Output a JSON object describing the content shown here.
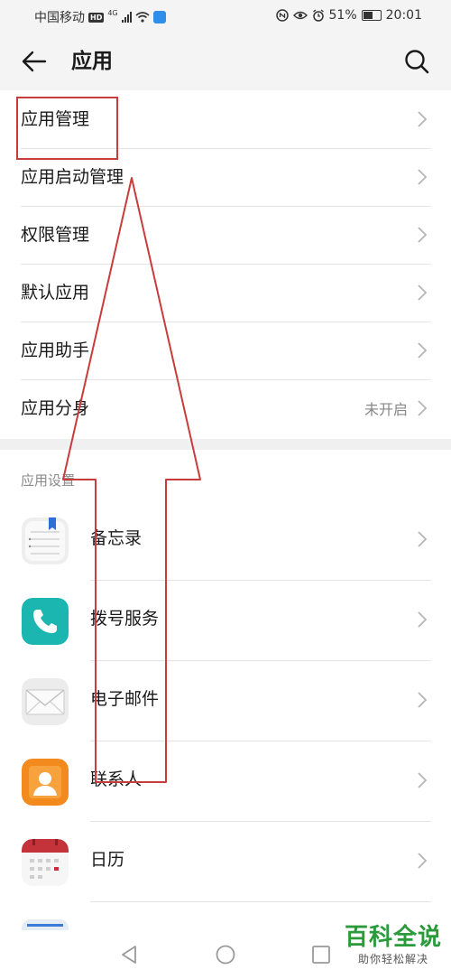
{
  "status_bar": {
    "carrier": "中国移动",
    "hd_badge": "HD",
    "network": "4G",
    "battery": "51%",
    "time": "20:01"
  },
  "header": {
    "title": "应用"
  },
  "menu": {
    "items": [
      {
        "label": "应用管理"
      },
      {
        "label": "应用启动管理"
      },
      {
        "label": "权限管理"
      },
      {
        "label": "默认应用"
      },
      {
        "label": "应用助手"
      },
      {
        "label": "应用分身",
        "value": "未开启"
      }
    ]
  },
  "settings": {
    "section_title": "应用设置",
    "apps": [
      {
        "label": "备忘录",
        "icon": "memo-icon"
      },
      {
        "label": "拨号服务",
        "icon": "phone-icon"
      },
      {
        "label": "电子邮件",
        "icon": "email-icon"
      },
      {
        "label": "联系人",
        "icon": "contacts-icon"
      },
      {
        "label": "日历",
        "icon": "calendar-icon"
      }
    ]
  },
  "watermark": {
    "main": "百科全说",
    "sub": "助你轻松解决"
  },
  "colors": {
    "annotation_red": "#c83c3c",
    "phone_teal": "#1bb6b0",
    "contacts_orange": "#f28a1e",
    "calendar_red": "#c4323a",
    "watermark_green": "#2a9a3a"
  }
}
